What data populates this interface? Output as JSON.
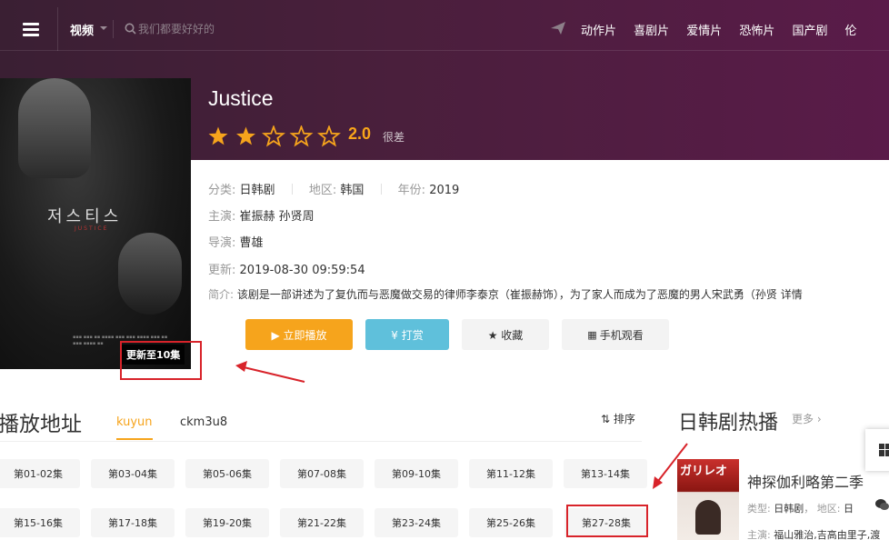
{
  "header": {
    "category": "视频",
    "search_placeholder": "我们都要好好的",
    "nav": [
      "动作片",
      "喜剧片",
      "爱情片",
      "恐怖片",
      "国产剧",
      "伦"
    ]
  },
  "poster": {
    "korean_title": "저스티스",
    "update_badge": "更新至10集"
  },
  "show": {
    "title": "Justice",
    "score": "2.0",
    "score_word": "很差",
    "stars_filled": 2,
    "stars_total": 5,
    "category_label": "分类:",
    "category_value": "日韩剧",
    "region_label": "地区:",
    "region_value": "韩国",
    "year_label": "年份:",
    "year_value": "2019",
    "cast_label": "主演:",
    "cast_value": "崔振赫 孙贤周",
    "director_label": "导演:",
    "director_value": "曹雄",
    "updated_label": "更新:",
    "updated_value": "2019-08-30 09:59:54",
    "intro_label": "简介:",
    "intro_value": "该剧是一部讲述为了复仇而与恶魔做交易的律师李泰京（崔振赫饰），为了家人而成为了恶魔的男人宋武勇（孙贤",
    "intro_more": "详情"
  },
  "actions": {
    "play": "▶ 立即播放",
    "tip": "¥ 打赏",
    "favorite": "★ 收藏",
    "mobile": "手机观看"
  },
  "playlist": {
    "title": "播放地址",
    "tabs": [
      "kuyun",
      "ckm3u8"
    ],
    "sort": "排序",
    "episodes": [
      "第01-02集",
      "第03-04集",
      "第05-06集",
      "第07-08集",
      "第09-10集",
      "第11-12集",
      "第13-14集",
      "第15-16集",
      "第17-18集",
      "第19-20集",
      "第21-22集",
      "第23-24集",
      "第25-26集",
      "第27-28集"
    ]
  },
  "sidebar": {
    "title": "日韩剧热播",
    "more": "更多",
    "item": {
      "thumb_text": "ガリレオ",
      "name": "神探伽利略第二季",
      "type_label": "类型:",
      "type_value": "日韩剧",
      "region_label": "地区:",
      "region_value": "日",
      "cast_label": "主演:",
      "cast_value": "福山雅治,吉高由里子,渡"
    }
  },
  "colors": {
    "accent": "#f6a41c",
    "tip": "#5fc0db",
    "highlight": "#d8232a"
  }
}
